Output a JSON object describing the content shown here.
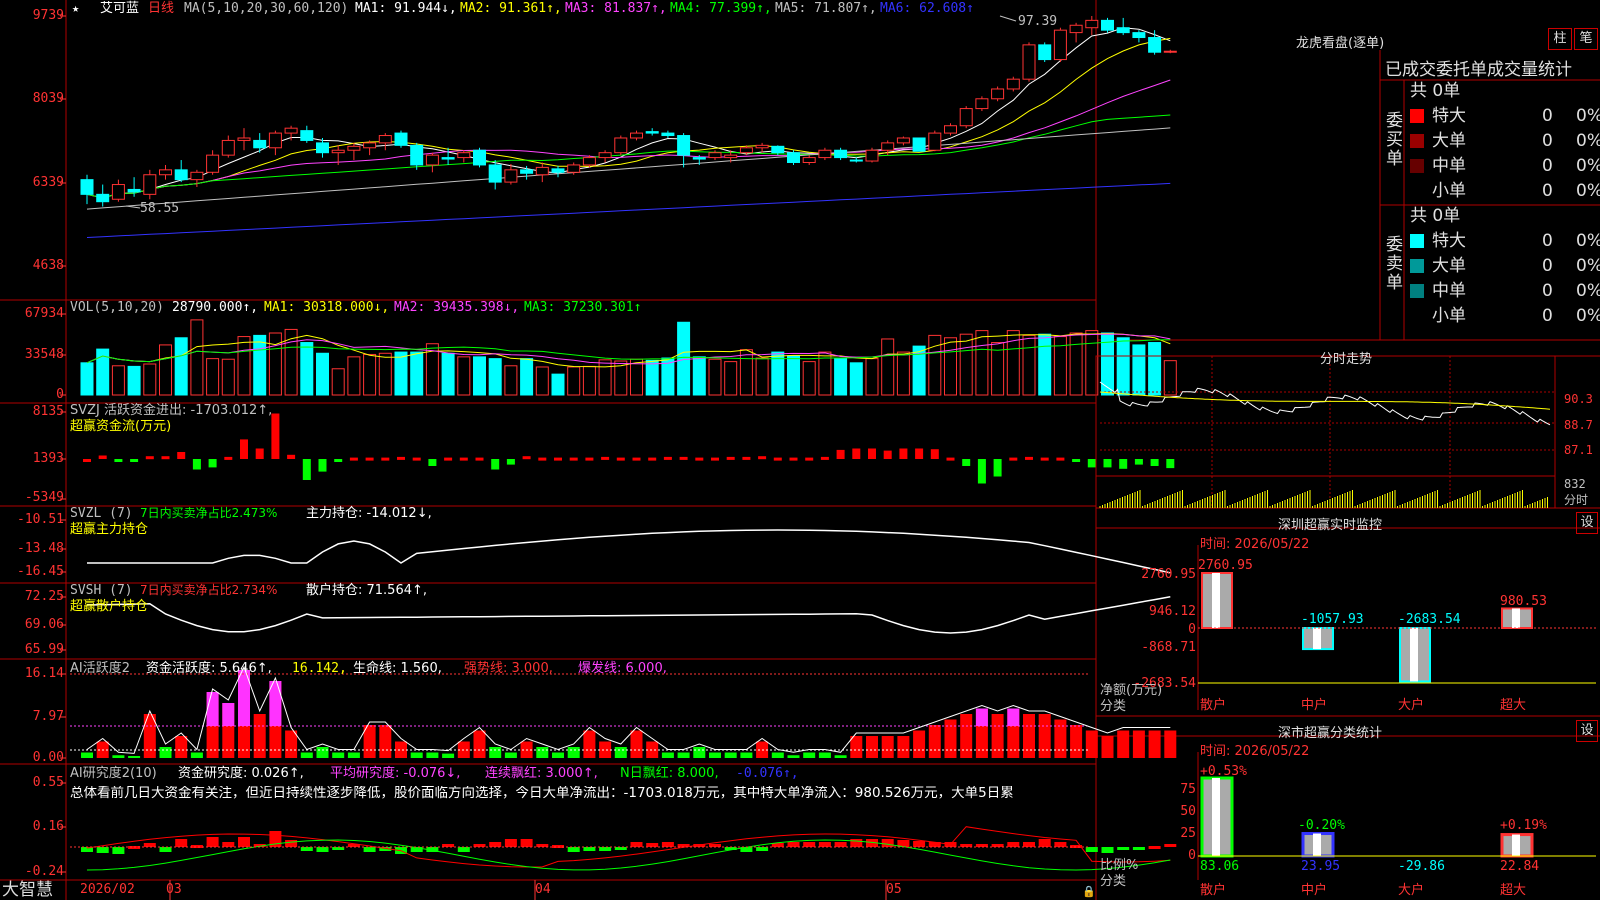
{
  "stock": {
    "name": "艾可蓝",
    "period": "日线",
    "price_max_label": "9739"
  },
  "price_panel": {
    "ma_params": "MA(5,10,20,30,60,120)",
    "ma1": "MA1: 91.944↓,",
    "ma2": "MA2: 91.361↑,",
    "ma3": "MA3: 81.837↑,",
    "ma4": "MA4: 77.399↑,",
    "ma5": "MA5: 71.807↑,",
    "ma6": "MA6: 62.608↑",
    "high_mark": "97.39",
    "low_mark": "58.55",
    "y_labels": [
      "9739",
      "8039",
      "6339",
      "4638"
    ]
  },
  "vol_panel": {
    "title": "VOL(5,10,20)",
    "value": "28790.000↑,",
    "ma1": "MA1: 30318.000↓,",
    "ma2": "MA2: 39435.398↓,",
    "ma3": "MA3: 37230.301↑",
    "y_labels": [
      "67934",
      "33548",
      "0"
    ]
  },
  "svzj_panel": {
    "title": "SVZJ  活跃资金进出: -1703.012↑,",
    "subtitle": "超赢资金流(万元)",
    "y_labels": [
      "8135",
      "1393",
      "-5349"
    ]
  },
  "svzl_panel": {
    "title": "SVZL (7)",
    "ratio": "7日内买卖净占比2.473%",
    "holding": "主力持仓: -14.012↓,",
    "subtitle": "超赢主力持仓",
    "y_labels": [
      "-10.51",
      "-13.48",
      "-16.45"
    ]
  },
  "svsh_panel": {
    "title": "SVSH (7)",
    "ratio": "7日内买卖净占比2.734%",
    "holding": "散户持仓: 71.564↑,",
    "subtitle": "超赢散户持仓",
    "y_labels": [
      "72.25",
      "69.06",
      "65.99"
    ]
  },
  "ai_active_panel": {
    "title": "AI活跃度2",
    "activity": "资金活跃度: 5.646↑,",
    "v2": "16.142,",
    "life": "生命线: 1.560,",
    "strong": "强势线: 3.000,",
    "burst": "爆发线: 6.000,",
    "y_labels": [
      "16.14",
      "7.97",
      "0.00"
    ]
  },
  "ai_research_panel": {
    "title": "AI研究度2(10)",
    "research": "资金研究度: 0.026↑,",
    "avg": "平均研究度: -0.076↓,",
    "streak": "连续飘红: 3.000↑,",
    "nday": "N日飘红: 8.000,",
    "last": "-0.076↑,",
    "summary": "总体看前几日大资金有关注，但近日持续性逐步降低，股价面临方向选择，今日大单净流出：-1703.018万元，其中特大单净流入：980.526万元，大单5日累",
    "y_labels": [
      "0.55",
      "0.16",
      "-0.24"
    ]
  },
  "footer": {
    "brand": "大智慧",
    "date_label": "2026/02",
    "months": [
      "03",
      "04",
      "05"
    ]
  },
  "right_panel": {
    "dragon_title": "龙虎看盘(逐单)",
    "btn_bar": "柱",
    "btn_pen": "笔",
    "stat_title": "已成交委托单成交量统计",
    "buy_label": "委买单",
    "sell_label": "委卖单",
    "buy_total": "共 0单",
    "sell_total": "共 0单",
    "buy_rows": [
      {
        "name": "特大",
        "count": "0",
        "pct": "0%",
        "color": "#ff0000"
      },
      {
        "name": "大单",
        "count": "0",
        "pct": "0%",
        "color": "#990000"
      },
      {
        "name": "中单",
        "count": "0",
        "pct": "0%",
        "color": "#660000"
      },
      {
        "name": "小单",
        "count": "0",
        "pct": "0%",
        "color": ""
      }
    ],
    "sell_rows": [
      {
        "name": "特大",
        "count": "0",
        "pct": "0%",
        "color": "#00ffff"
      },
      {
        "name": "大单",
        "count": "0",
        "pct": "0%",
        "color": "#009999"
      },
      {
        "name": "中单",
        "count": "0",
        "pct": "0%",
        "color": "#008080"
      },
      {
        "name": "小单",
        "count": "0",
        "pct": "0%",
        "color": ""
      }
    ],
    "intraday_title": "分时走势",
    "intraday_labels": [
      "90.3",
      "88.7",
      "87.1"
    ],
    "intraday_vol_label": "832",
    "intraday_vol_unit": "分时",
    "sz_title": "深圳超赢实时监控",
    "sz_settings": "设",
    "sz_time": "时间: 2026/05/22",
    "sz_y": [
      "2760.95",
      "946.12",
      "0",
      "-868.71",
      "-2683.54"
    ],
    "sz_values": [
      {
        "cat": "散户",
        "value": "2760.95",
        "num": 2760.95
      },
      {
        "cat": "中户",
        "value": "-1057.93",
        "num": -1057.93
      },
      {
        "cat": "大户",
        "value": "-2683.54",
        "num": -2683.54
      },
      {
        "cat": "超大",
        "value": "980.53",
        "num": 980.53
      }
    ],
    "sz_ylabel": "净额(万元)",
    "sz_xlabel": "分类",
    "cls_title": "深市超赢分类统计",
    "cls_settings": "设",
    "cls_time": "时间: 2026/05/22",
    "cls_y": [
      "75",
      "50",
      "25",
      "0"
    ],
    "cls_top": [
      "+0.53%",
      "-0.20%",
      "",
      "+0.19%"
    ],
    "cls_values": [
      {
        "cat": "散户",
        "value": "83.06",
        "num": 83.06
      },
      {
        "cat": "中户",
        "value": "23.95",
        "num": 23.95
      },
      {
        "cat": "大户",
        "value": "-29.86",
        "num": -29.86
      },
      {
        "cat": "超大",
        "value": "22.84",
        "num": 22.84
      }
    ],
    "cls_ylabel": "比例%",
    "cls_xlabel": "分类"
  },
  "chart_data": {
    "type": "candlestick",
    "candles": [
      [
        64,
        65,
        59,
        61
      ],
      [
        61,
        63,
        58.5,
        59.5
      ],
      [
        60,
        64,
        59.5,
        63
      ],
      [
        62,
        64.5,
        60.5,
        61.5
      ],
      [
        61,
        66,
        60,
        65
      ],
      [
        65,
        67,
        64,
        66
      ],
      [
        66,
        68,
        63.5,
        64
      ],
      [
        64,
        66,
        62.5,
        65.5
      ],
      [
        65.5,
        70,
        65,
        69
      ],
      [
        69,
        73,
        68.5,
        72
      ],
      [
        72,
        74.5,
        70,
        72.5
      ],
      [
        72,
        73.5,
        69.5,
        70.5
      ],
      [
        70.5,
        74,
        69,
        73.5
      ],
      [
        73.5,
        75,
        72,
        74.5
      ],
      [
        74,
        75,
        71.5,
        72
      ],
      [
        71.5,
        72.5,
        68.5,
        69.5
      ],
      [
        69.5,
        71,
        67,
        70
      ],
      [
        70,
        71.5,
        68,
        70.8
      ],
      [
        70.5,
        72,
        69,
        71.5
      ],
      [
        71.5,
        73.5,
        70,
        73
      ],
      [
        73.5,
        74,
        70.5,
        71
      ],
      [
        71,
        71.5,
        66,
        67
      ],
      [
        67,
        69.5,
        65.5,
        69
      ],
      [
        68.5,
        70.5,
        67,
        68.2
      ],
      [
        68.5,
        70,
        67.5,
        69.5
      ],
      [
        70,
        70.5,
        66.5,
        67
      ],
      [
        67,
        68,
        62,
        63.5
      ],
      [
        63.5,
        67.2,
        63,
        66
      ],
      [
        66,
        66.8,
        64,
        65.3
      ],
      [
        65,
        67.5,
        63.5,
        66.5
      ],
      [
        66.2,
        66.8,
        64.5,
        65.5
      ],
      [
        65.5,
        67.5,
        65,
        67
      ],
      [
        67,
        69,
        66.5,
        68.5
      ],
      [
        68.5,
        70,
        67.5,
        69.5
      ],
      [
        69.5,
        73,
        69,
        72.5
      ],
      [
        72.5,
        74,
        72,
        73.5
      ],
      [
        73.8,
        74.5,
        73,
        73.5
      ],
      [
        73.5,
        74,
        72.5,
        73
      ],
      [
        73,
        73.5,
        66.5,
        69
      ],
      [
        68.5,
        69,
        67,
        68.2
      ],
      [
        68.5,
        70,
        68,
        69.5
      ],
      [
        68.5,
        70,
        67.5,
        69
      ],
      [
        69.5,
        71,
        69,
        70.5
      ],
      [
        70.5,
        71.5,
        69.5,
        71
      ],
      [
        70.8,
        71,
        69,
        69.5
      ],
      [
        69.5,
        70,
        67,
        67.5
      ],
      [
        67.5,
        69,
        67,
        68.5
      ],
      [
        68.5,
        70.5,
        68,
        70
      ],
      [
        70,
        70.5,
        68,
        68.5
      ],
      [
        68,
        68.5,
        67.5,
        67.8
      ],
      [
        67.8,
        70.5,
        67.5,
        70
      ],
      [
        70,
        72,
        69,
        71.5
      ],
      [
        71.5,
        72.8,
        71,
        72.5
      ],
      [
        72.5,
        72.6,
        69.8,
        69.8
      ],
      [
        70,
        74,
        69.8,
        73.5
      ],
      [
        73.5,
        75.5,
        73,
        75
      ],
      [
        75,
        79,
        74.5,
        78.5
      ],
      [
        78.5,
        81,
        78,
        80.5
      ],
      [
        80.5,
        83,
        80,
        82.5
      ],
      [
        82.5,
        85,
        82,
        84.5
      ],
      [
        84.5,
        92,
        84,
        91.5
      ],
      [
        91.5,
        92,
        88,
        88.5
      ],
      [
        88.5,
        95,
        88,
        94.5
      ],
      [
        94,
        96,
        92,
        95.5
      ],
      [
        95,
        97.39,
        93.5,
        96.5
      ],
      [
        96.5,
        97,
        94,
        94.5
      ],
      [
        95,
        97,
        93.5,
        94
      ],
      [
        94,
        94.5,
        92,
        93
      ],
      [
        93,
        94.5,
        89.5,
        90
      ],
      [
        90,
        90.5,
        89.8,
        90.2
      ]
    ],
    "volume": [
      27000,
      38500,
      24500,
      24000,
      26000,
      42000,
      48000,
      63000,
      30500,
      30000,
      49000,
      50000,
      52000,
      55000,
      44000,
      35000,
      22000,
      32000,
      34000,
      35000,
      36000,
      36000,
      43000,
      35000,
      32000,
      32000,
      30500,
      24500,
      30500,
      23500,
      17500,
      23500,
      24000,
      29500,
      28500,
      30000,
      29000,
      31000,
      61000,
      32000,
      30000,
      28000,
      38000,
      31000,
      36000,
      33000,
      28000,
      36000,
      31000,
      27000,
      30500,
      47000,
      36000,
      41000,
      50000,
      48000,
      51000,
      54000,
      44000,
      54000,
      50000,
      51000,
      49000,
      52000,
      54000,
      52000,
      48000,
      42000,
      44000,
      28790
    ],
    "ylim": [
      46.38,
      97.39
    ],
    "months": [
      "03",
      "04",
      "05"
    ]
  }
}
